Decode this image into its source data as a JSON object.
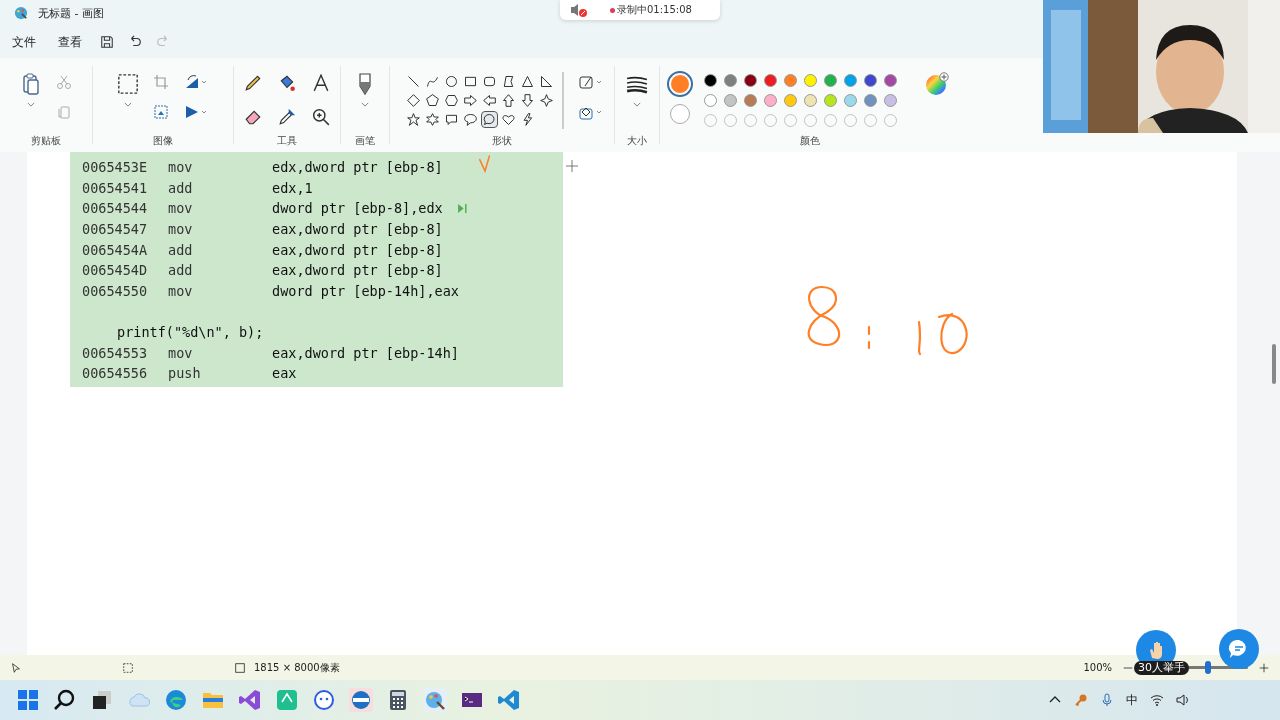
{
  "window": {
    "title": "无标题 - 画图"
  },
  "recording": {
    "text": "录制中01:15:08"
  },
  "menu": [
    {
      "label": "文件"
    },
    {
      "label": "查看"
    }
  ],
  "ribbon": {
    "groups": [
      {
        "kind": "clipboard",
        "label": "剪贴板"
      },
      {
        "label": "图像"
      },
      {
        "kind": "tools",
        "label": "工具"
      },
      {
        "kind": "brush",
        "label": "画笔"
      },
      {
        "kind": "shapes",
        "label": "形状"
      },
      {
        "kind": "size",
        "label": "大小"
      },
      {
        "kind": "colors",
        "label": "颜色"
      }
    ],
    "shapes": [
      {
        "kind": "line",
        "selected": false
      },
      {
        "kind": "curve",
        "selected": false
      },
      {
        "kind": "oval",
        "selected": false
      },
      {
        "kind": "rect",
        "selected": false
      },
      {
        "kind": "roundrect",
        "selected": false
      },
      {
        "kind": "polygon",
        "selected": false
      },
      {
        "kind": "triangle",
        "selected": false
      },
      {
        "kind": "righttriangle",
        "selected": false
      },
      {
        "kind": "diamond",
        "selected": false
      },
      {
        "kind": "pentagon",
        "selected": false
      },
      {
        "kind": "hexagon",
        "selected": false
      },
      {
        "kind": "arrowright",
        "selected": false
      },
      {
        "kind": "arrowleft",
        "selected": false
      },
      {
        "kind": "arrowup",
        "selected": false
      },
      {
        "kind": "arrowdown",
        "selected": false
      },
      {
        "kind": "star4",
        "selected": false
      },
      {
        "kind": "star5",
        "selected": false
      },
      {
        "kind": "star6",
        "selected": false
      },
      {
        "kind": "calloutrect",
        "selected": false
      },
      {
        "kind": "calloutoval",
        "selected": false
      },
      {
        "kind": "calloutround",
        "selected": true
      },
      {
        "kind": "heart",
        "selected": false
      },
      {
        "kind": "lightning",
        "selected": false
      }
    ],
    "current_colors": [
      {
        "color": "#ff7f27",
        "selected": true
      },
      {
        "color": "#ffffff",
        "selected": false
      }
    ],
    "palette": [
      {
        "color": "#000000"
      },
      {
        "color": "#7f7f7f"
      },
      {
        "color": "#880015"
      },
      {
        "color": "#ed1c24"
      },
      {
        "color": "#ff7f27"
      },
      {
        "color": "#fff200"
      },
      {
        "color": "#22b14c"
      },
      {
        "color": "#00a2e8"
      },
      {
        "color": "#3f48cc"
      },
      {
        "color": "#a349a4"
      },
      {
        "color": "#ffffff"
      },
      {
        "color": "#c3c3c3"
      },
      {
        "color": "#b97a57"
      },
      {
        "color": "#ffaec9"
      },
      {
        "color": "#ffc90e"
      },
      {
        "color": "#efe4b0"
      },
      {
        "color": "#b5e61d"
      },
      {
        "color": "#99d9ea"
      },
      {
        "color": "#7092be"
      },
      {
        "color": "#c8bfe7"
      }
    ]
  },
  "code": [
    {
      "kind": "asm",
      "address": "0065453E",
      "op": "mov",
      "args": "edx,dword ptr [ebp-8]",
      "current": false
    },
    {
      "kind": "asm",
      "address": "00654541",
      "op": "add",
      "args": "edx,1",
      "current": false
    },
    {
      "kind": "asm",
      "address": "00654544",
      "op": "mov",
      "args": "dword ptr [ebp-8],edx",
      "current": true
    },
    {
      "kind": "asm",
      "address": "00654547",
      "op": "mov",
      "args": "eax,dword ptr [ebp-8]",
      "current": false
    },
    {
      "kind": "asm",
      "address": "0065454A",
      "op": "add",
      "args": "eax,dword ptr [ebp-8]",
      "current": false
    },
    {
      "kind": "asm",
      "address": "0065454D",
      "op": "add",
      "args": "eax,dword ptr [ebp-8]",
      "current": false
    },
    {
      "kind": "asm",
      "address": "00654550",
      "op": "mov",
      "args": "dword ptr [ebp-14h],eax",
      "current": false
    },
    {
      "kind": "blank"
    },
    {
      "kind": "source",
      "text": "printf(\"%d\\n\", b);"
    },
    {
      "kind": "asm",
      "address": "00654553",
      "op": "mov",
      "args": "eax,dword ptr [ebp-14h]",
      "current": false
    },
    {
      "kind": "asm",
      "address": "00654556",
      "op": "push",
      "args": "eax",
      "current": false
    }
  ],
  "status_bar": {
    "size": "1815 × 8000像素",
    "zoom": "100%",
    "zoom_slider": {
      "level": 0.5
    }
  },
  "raise_hand": {
    "text": "30人举手"
  },
  "taskbar": {
    "apps": [
      {
        "kind": "start"
      },
      {
        "kind": "search"
      },
      {
        "kind": "taskview"
      },
      {
        "kind": "cloud"
      },
      {
        "kind": "edge"
      },
      {
        "kind": "folder"
      },
      {
        "kind": "vs"
      },
      {
        "kind": "pdf"
      },
      {
        "kind": "chat"
      },
      {
        "kind": "ios"
      },
      {
        "kind": "calc"
      },
      {
        "kind": "paint"
      },
      {
        "kind": "terminal"
      },
      {
        "kind": "vscode"
      }
    ],
    "ime": "中"
  }
}
